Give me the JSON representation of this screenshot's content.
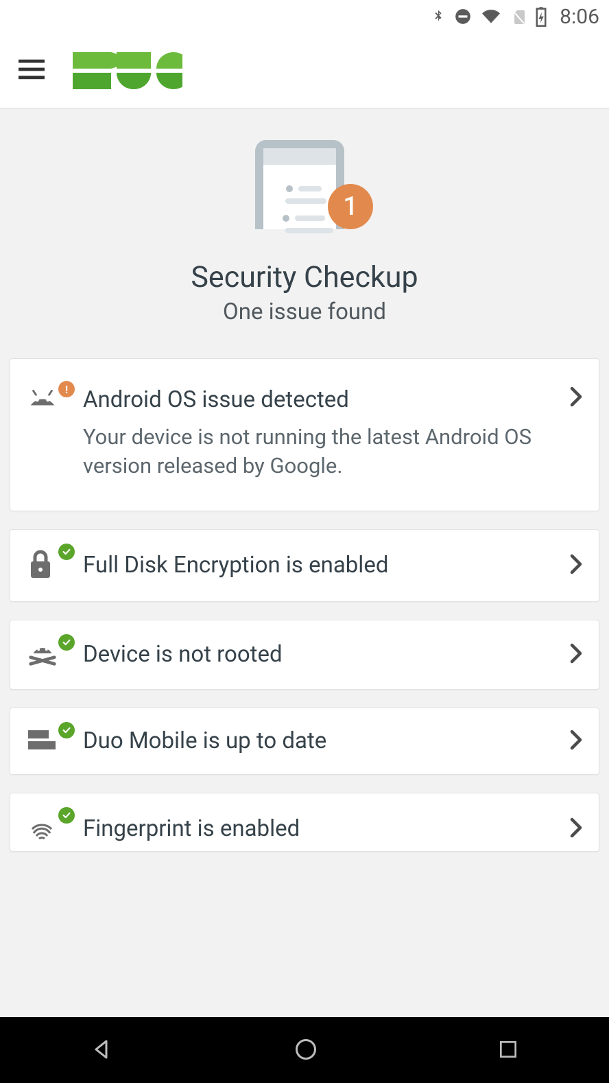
{
  "status_bar": {
    "time": "8:06"
  },
  "hero": {
    "badge_count": "1",
    "title": "Security Checkup",
    "subtitle": "One issue found"
  },
  "items": [
    {
      "title": "Android OS issue detected",
      "description": "Your device is not running the latest Android OS version released by Google.",
      "status": "warn",
      "icon": "android"
    },
    {
      "title": "Full Disk Encryption is enabled",
      "status": "ok",
      "icon": "lock"
    },
    {
      "title": "Device is not rooted",
      "status": "ok",
      "icon": "android-crossbones"
    },
    {
      "title": "Duo Mobile is up to date",
      "status": "ok",
      "icon": "duo"
    },
    {
      "title": "Fingerprint is enabled",
      "status": "ok",
      "icon": "fingerprint"
    }
  ]
}
